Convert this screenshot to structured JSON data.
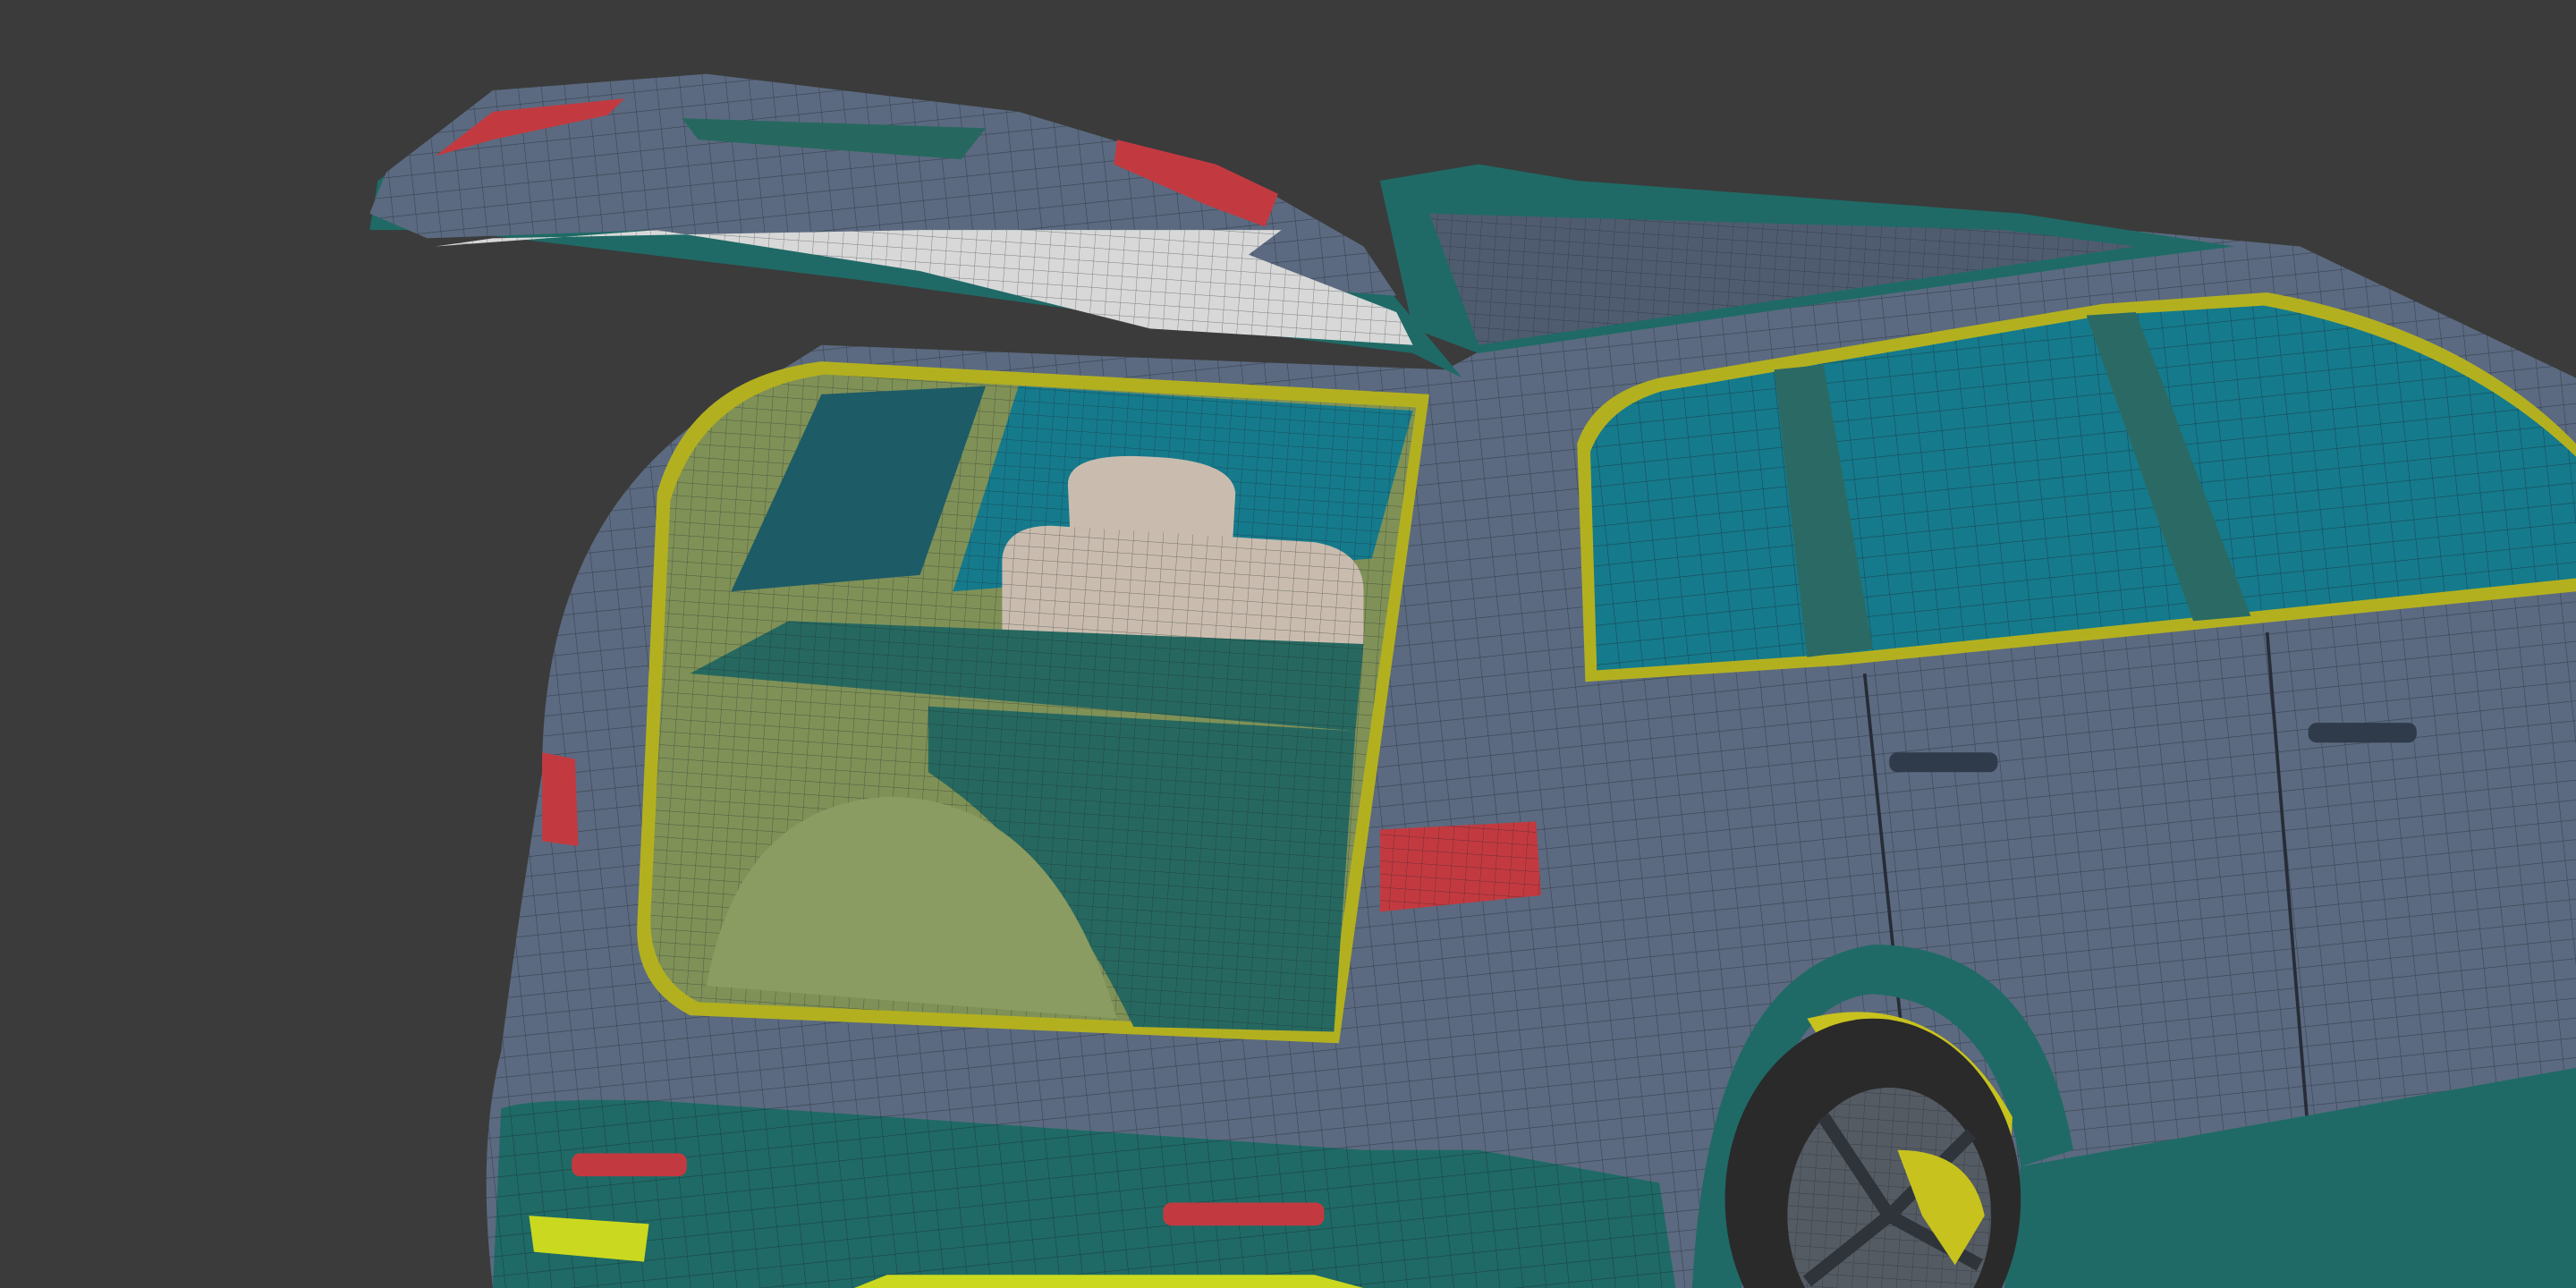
{
  "colors": {
    "background": "#3b3b3b",
    "body": "#5b6a80",
    "body_light": "#6d7c92",
    "trim_teal": "#1f6a66",
    "glass": "#157a8c",
    "interior": "#7f9157",
    "cargo_floor": "#26685f",
    "seal": "#b3b020",
    "light_red": "#c23a40",
    "seat": "#c9bcae",
    "tire": "#2a2a2a",
    "brake": "#c8c21e",
    "wire": "#1a1f28"
  }
}
